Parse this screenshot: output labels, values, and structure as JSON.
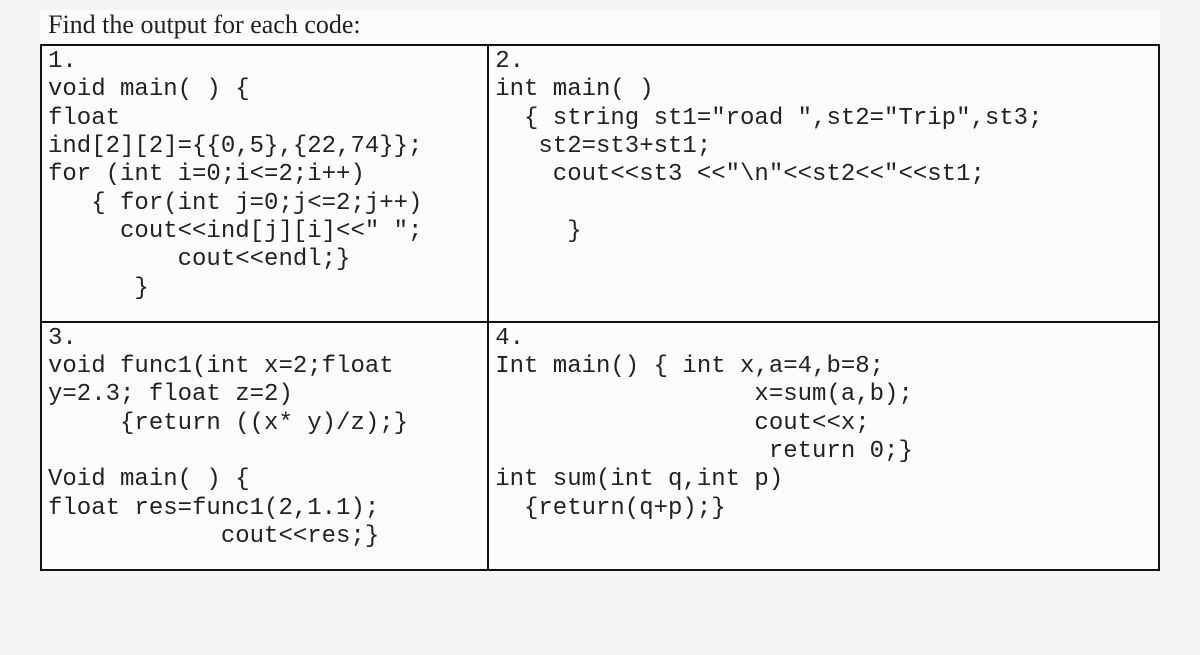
{
  "title": "Find the output for each code:",
  "cells": {
    "cell1": "1.\nvoid main( ) {\nfloat\nind[2][2]={{0,5},{22,74}};\nfor (int i=0;i<=2;i++)\n   { for(int j=0;j<=2;j++)\n     cout<<ind[j][i]<<\" \";\n         cout<<endl;}\n      }",
    "cell2": "2.\nint main( )\n  { string st1=\"road \",st2=\"Trip\",st3;\n   st2=st3+st1;\n    cout<<st3 <<\"\\n\"<<st2<<\"<<st1;\n\n     }",
    "cell3": "3.\nvoid func1(int x=2;float\ny=2.3; float z=2)\n     {return ((x* y)/z);}\n\nVoid main( ) {\nfloat res=func1(2,1.1);\n            cout<<res;}",
    "cell4": "4.\nInt main() { int x,a=4,b=8;\n                  x=sum(a,b);\n                  cout<<x;\n                   return 0;}\nint sum(int q,int p)\n  {return(q+p);}"
  }
}
